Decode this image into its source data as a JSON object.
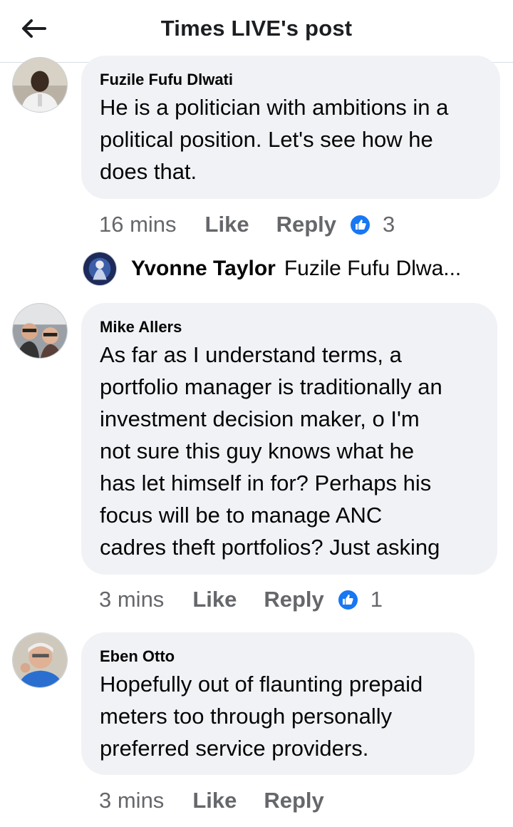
{
  "header": {
    "title": "Times LIVE's post",
    "back_icon": "arrow-left-icon"
  },
  "comments": [
    {
      "author": "Fuzile Fufu Dlwati",
      "text": "He is a politician with ambitions in a\npolitical position. Let's see how he\ndoes that.",
      "time": "16 mins",
      "like_label": "Like",
      "reply_label": "Reply",
      "reaction_icon": "thumbs-up-icon",
      "reaction_count": "3"
    },
    {
      "author": "Mike Allers",
      "text": "As far as I understand terms, a\nportfolio manager is traditionally an\ninvestment decision maker, o I'm\nnot sure this guy knows what he\nhas let himself in for? Perhaps his\nfocus will be to manage ANC\ncadres theft portfolios? Just asking",
      "time": "3 mins",
      "like_label": "Like",
      "reply_label": "Reply",
      "reaction_icon": "thumbs-up-icon",
      "reaction_count": "1"
    },
    {
      "author": "Eben Otto",
      "text": "Hopefully out of flaunting prepaid\nmeters too through personally\npreferred service providers.",
      "time": "3 mins",
      "like_label": "Like",
      "reply_label": "Reply"
    }
  ],
  "reply_preview": {
    "name": "Yvonne Taylor",
    "snippet": "Fuzile Fufu Dlwa..."
  },
  "colors": {
    "accent": "#1877f2",
    "bubble": "#f0f2f5",
    "secondary_text": "#65676b"
  }
}
